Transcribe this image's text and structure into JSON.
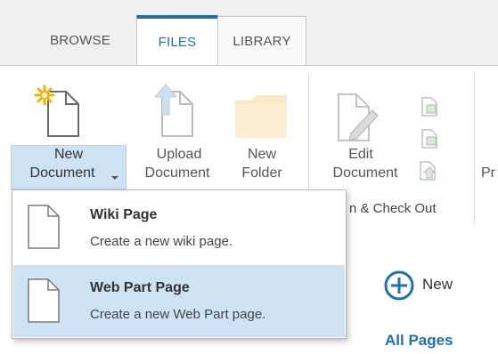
{
  "tabs": [
    {
      "label": "BROWSE"
    },
    {
      "label": "FILES"
    },
    {
      "label": "LIBRARY"
    }
  ],
  "ribbon": {
    "new_document": {
      "line1": "New",
      "line2": "Document",
      "icon": "new-document-icon"
    },
    "upload_document": {
      "line1": "Upload",
      "line2": "Document",
      "icon": "upload-icon"
    },
    "new_folder": {
      "line1": "New",
      "line2": "Folder",
      "icon": "folder-icon"
    },
    "edit_document": {
      "line1": "Edit",
      "line2": "Document",
      "icon": "edit-document-icon"
    },
    "group_label_partial": "n & Check Out",
    "next_button_partial": "Pr"
  },
  "dropdown": {
    "items": [
      {
        "title": "Wiki Page",
        "desc": "Create a new wiki page."
      },
      {
        "title": "Web Part Page",
        "desc": "Create a new Web Part page."
      }
    ]
  },
  "page": {
    "new_label": "New",
    "all_pages": "All Pages"
  },
  "colors": {
    "accent": "#1f6fb5",
    "selection": "#cfe3f4"
  }
}
